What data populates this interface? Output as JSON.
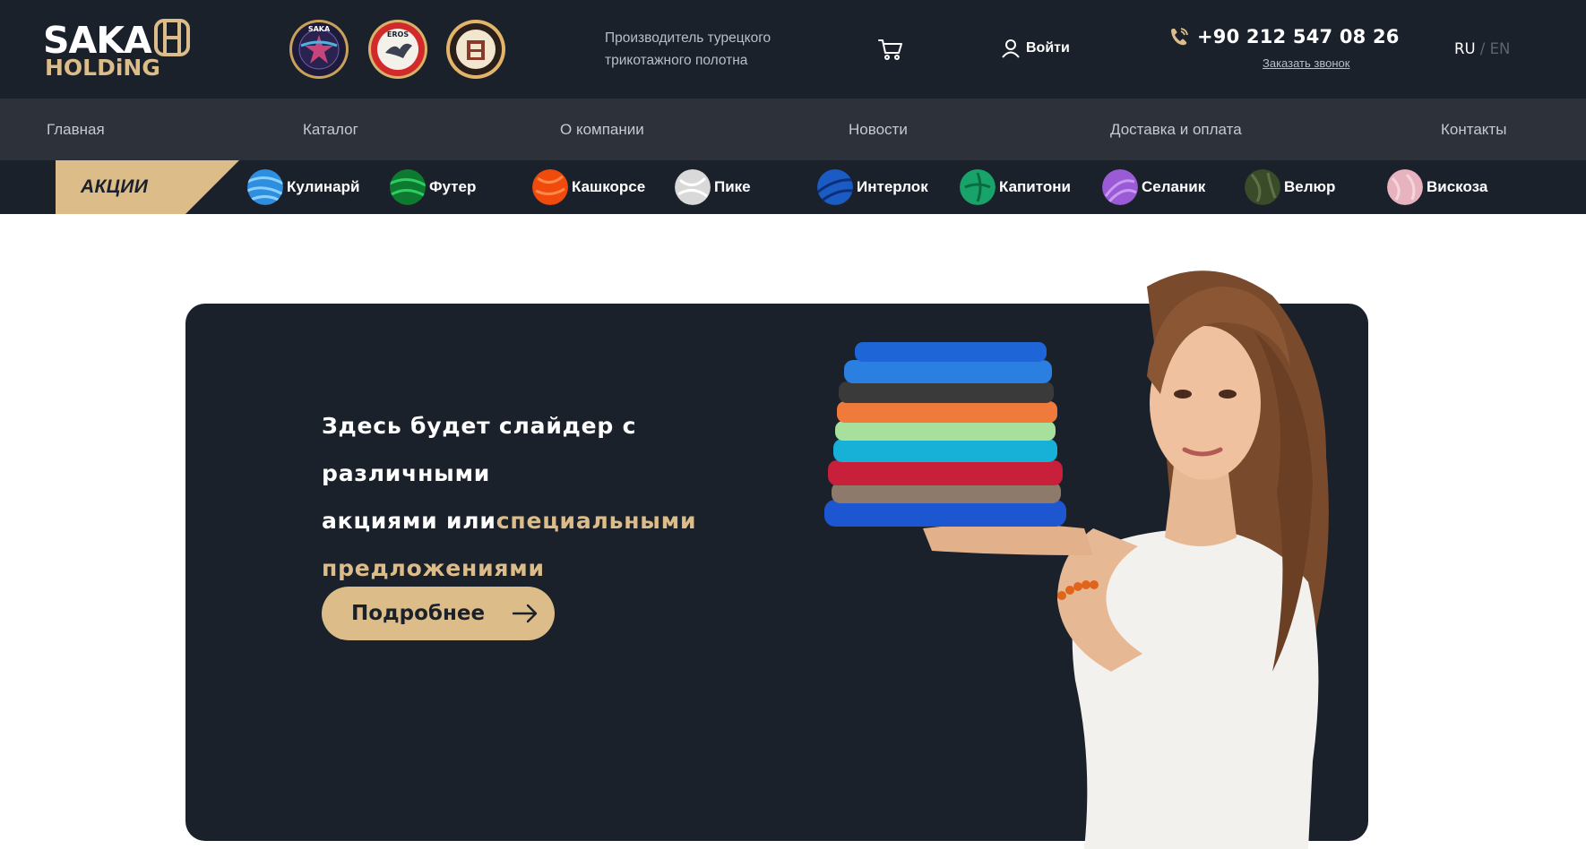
{
  "header": {
    "logo": {
      "line1": "SAKA",
      "line2": "HOLDiNG"
    },
    "badges": [
      {
        "name": "saka-emblem",
        "text": "SAKA"
      },
      {
        "name": "eros-emblem",
        "text": "EROS"
      },
      {
        "name": "saka-tekstil-emblem",
        "text": ""
      }
    ],
    "tagline_line1": "Производитель турецкого",
    "tagline_line2": "трикотажного полотна",
    "cart_icon": "cart-icon",
    "login_label": "Войти",
    "phone": "+90 212 547 08 26",
    "callback_label": "Заказать звонок",
    "lang": {
      "ru": "RU",
      "sep": " / ",
      "en": "EN"
    }
  },
  "nav": {
    "items": [
      "Главная",
      "Каталог",
      "О компании",
      "Новости",
      "Доставка и оплата",
      "Контакты"
    ]
  },
  "categories": {
    "promo_label": "АКЦИИ",
    "items": [
      {
        "label": "Кулинарй",
        "color": "#2e8ee0"
      },
      {
        "label": "Футер",
        "color": "#0e7a2f"
      },
      {
        "label": "Кашкорсе",
        "color": "#f04a0c"
      },
      {
        "label": "Пике",
        "color": "#d9d9d9"
      },
      {
        "label": "Интерлок",
        "color": "#1a5bc4"
      },
      {
        "label": "Капитони",
        "color": "#18a36a"
      },
      {
        "label": "Селаник",
        "color": "#9b5ad6"
      },
      {
        "label": "Велюр",
        "color": "#3a4b2a"
      },
      {
        "label": "Вискоза",
        "color": "#e7b3bf"
      }
    ]
  },
  "hero": {
    "line1": "Здесь будет слайдер с различными",
    "line2_white": "акциями или",
    "line2_gold": "специальными",
    "line3_gold": "предложениями",
    "button_label": "Подробнее",
    "accent_color": "#dcbd8a",
    "background": "#1b212b"
  }
}
